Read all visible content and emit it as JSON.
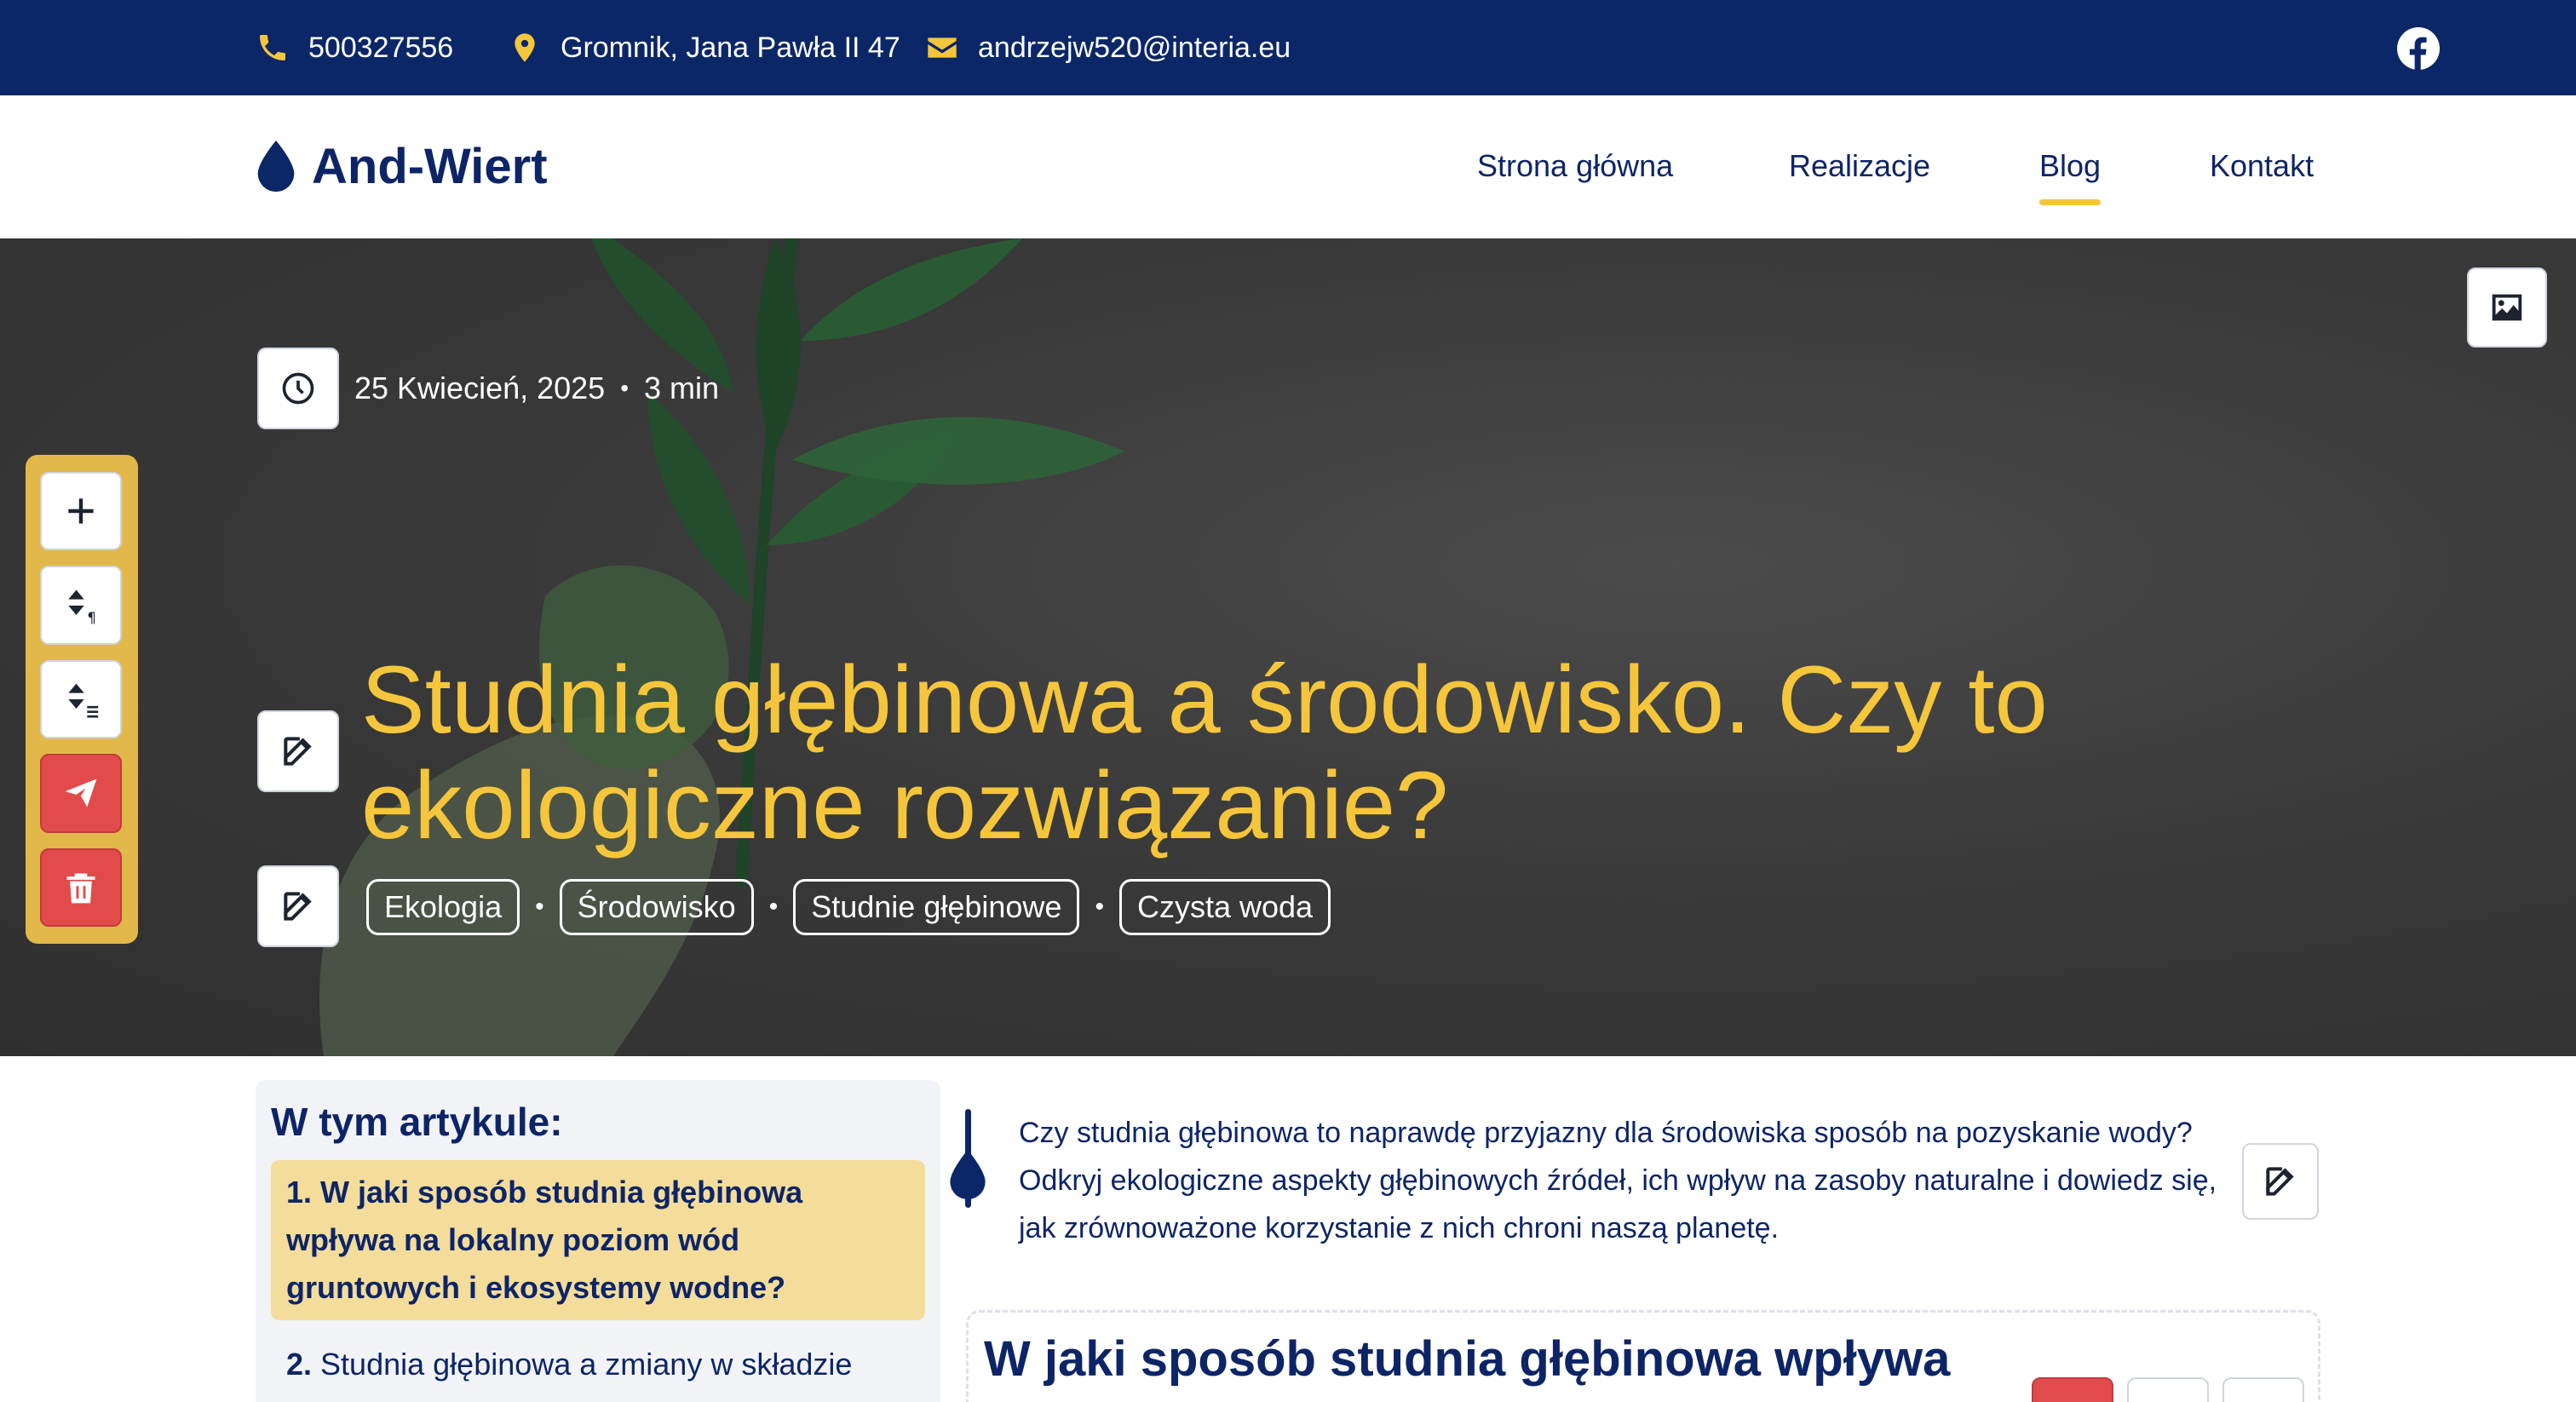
{
  "contact": {
    "phone": "500327556",
    "address": "Gromnik, Jana Pawła II 47",
    "email": "andrzejw520@interia.eu"
  },
  "brand": {
    "name": "And-Wiert"
  },
  "nav": {
    "items": [
      "Strona główna",
      "Realizacje",
      "Blog",
      "Kontakt"
    ],
    "active": "Blog"
  },
  "post": {
    "date": "25 Kwiecień, 2025",
    "reading_time": "3 min",
    "title": "Studnia głębinowa a środowisko. Czy to ekologiczne rozwiązanie?",
    "tags": [
      "Ekologia",
      "Środowisko",
      "Studnie głębinowe",
      "Czysta woda"
    ]
  },
  "toc": {
    "heading": "W tym artykule:",
    "items": [
      {
        "num": "1.",
        "text": "W jaki sposób studnia głębinowa wpływa na lokalny poziom wód gruntowych i ekosystemy wodne?"
      },
      {
        "num": "2.",
        "text": "Studnia głębinowa a zmiany w składzie"
      }
    ]
  },
  "intro": "Czy studnia głębinowa to naprawdę przyjazny dla środowiska sposób na pozyskanie wody? Odkryj ekologiczne aspekty głębinowych źródeł, ich wpływ na zasoby naturalne i dowiedz się, jak zrównoważone korzystanie z nich chroni naszą planetę.",
  "section": {
    "heading": "W jaki sposób studnia głębinowa wpływa na lokalny poziom wód gruntowych i"
  },
  "colors": {
    "navy": "#0c2767",
    "accent": "#f5c63b",
    "danger": "#e24b4b"
  }
}
